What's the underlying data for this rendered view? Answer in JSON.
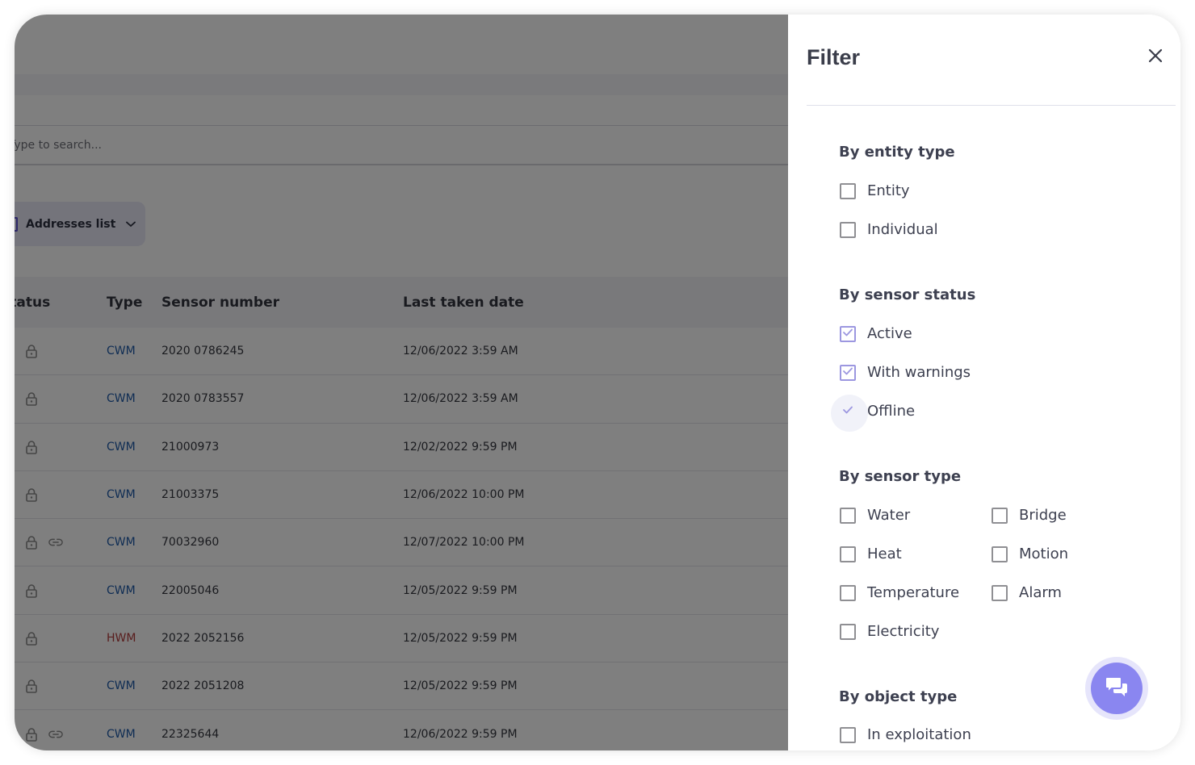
{
  "page": {
    "search": {
      "placeholder": "Type to search..."
    },
    "addresses_button": {
      "label": "Addresses list",
      "icon": "list-icon"
    },
    "table": {
      "columns": [
        "Status",
        "Type",
        "Sensor number",
        "Last taken date"
      ],
      "rows": [
        {
          "status_icons": [
            "lock-icon"
          ],
          "type": "CWM",
          "sensor_number": "2020 0786245",
          "last_taken_date": "12/06/2022 3:59 AM"
        },
        {
          "status_icons": [
            "lock-icon"
          ],
          "type": "CWM",
          "sensor_number": "2020 0783557",
          "last_taken_date": "12/06/2022 3:59 AM"
        },
        {
          "status_icons": [
            "lock-icon"
          ],
          "type": "CWM",
          "sensor_number": "21000973",
          "last_taken_date": "12/02/2022 9:59 PM"
        },
        {
          "status_icons": [
            "lock-icon"
          ],
          "type": "CWM",
          "sensor_number": "21003375",
          "last_taken_date": "12/06/2022 10:00 PM"
        },
        {
          "status_icons": [
            "lock-icon",
            "link-icon"
          ],
          "type": "CWM",
          "sensor_number": "70032960",
          "last_taken_date": "12/07/2022 10:00 PM"
        },
        {
          "status_icons": [
            "lock-icon"
          ],
          "type": "CWM",
          "sensor_number": "22005046",
          "last_taken_date": "12/05/2022 9:59 PM"
        },
        {
          "status_icons": [
            "lock-icon"
          ],
          "type": "HWM",
          "sensor_number": "2022 2052156",
          "last_taken_date": "12/05/2022 9:59 PM"
        },
        {
          "status_icons": [
            "lock-icon"
          ],
          "type": "CWM",
          "sensor_number": "2022 2051208",
          "last_taken_date": "12/05/2022 9:59 PM"
        },
        {
          "status_icons": [
            "lock-icon",
            "link-icon"
          ],
          "type": "CWM",
          "sensor_number": "22325644",
          "last_taken_date": "12/06/2022 9:59 PM"
        }
      ]
    }
  },
  "filter": {
    "title": "Filter",
    "close_icon": "close-icon",
    "sections": [
      {
        "title": "By entity type",
        "options": [
          {
            "label": "Entity",
            "checked": false
          },
          {
            "label": "Individual",
            "checked": false
          }
        ]
      },
      {
        "title": "By sensor status",
        "options": [
          {
            "label": "Active",
            "checked": true
          },
          {
            "label": "With warnings",
            "checked": true
          },
          {
            "label": "Offline",
            "checked": true
          }
        ]
      },
      {
        "title": "By sensor type",
        "options": [
          {
            "label": "Water",
            "checked": false
          },
          {
            "label": "Heat",
            "checked": false
          },
          {
            "label": "Temperature",
            "checked": false
          },
          {
            "label": "Electricity",
            "checked": false
          },
          {
            "label": "Bridge",
            "checked": false
          },
          {
            "label": "Motion",
            "checked": false
          },
          {
            "label": "Alarm",
            "checked": false
          }
        ]
      },
      {
        "title": "By object type",
        "options": [
          {
            "label": "In exploitation",
            "checked": false
          }
        ]
      }
    ]
  },
  "chat_button": {
    "icon": "chat-icon"
  },
  "colors": {
    "accent": "#8a86f0",
    "checkbox_checked": "#9c97e0",
    "type_cwm": "#1f5aa8",
    "type_hwm": "#b23a3a",
    "overlay": "rgba(0,0,0,0.5)"
  }
}
